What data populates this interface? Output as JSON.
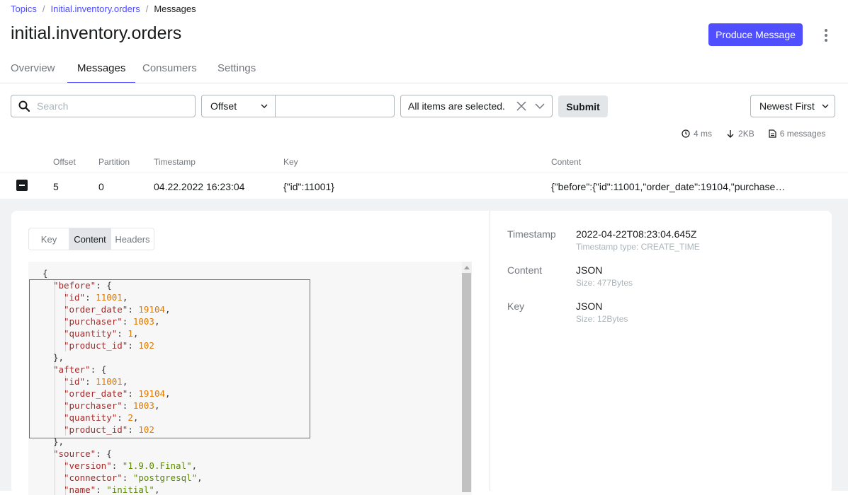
{
  "breadcrumb": {
    "topics": "Topics",
    "topic": "Initial.inventory.orders",
    "current": "Messages",
    "separator": "/"
  },
  "title": "initial.inventory.orders",
  "actions": {
    "produce": "Produce Message",
    "more_icon": "kebab-menu-icon"
  },
  "tabs": [
    {
      "label": "Overview",
      "active": false
    },
    {
      "label": "Messages",
      "active": true
    },
    {
      "label": "Consumers",
      "active": false
    },
    {
      "label": "Settings",
      "active": false
    }
  ],
  "filters": {
    "search_placeholder": "Search",
    "seek_type": "Offset",
    "offset_value": "",
    "partitions": "All items are selected.",
    "submit": "Submit",
    "sort": "Newest First"
  },
  "stats": {
    "time": "4 ms",
    "size": "2KB",
    "messages": "6 messages"
  },
  "table": {
    "headers": {
      "offset": "Offset",
      "partition": "Partition",
      "timestamp": "Timestamp",
      "key": "Key",
      "content": "Content"
    },
    "row": {
      "offset": "5",
      "partition": "0",
      "timestamp": "04.22.2022 16:23:04",
      "key": "{\"id\":11001}",
      "content": "{\"before\":{\"id\":11001,\"order_date\":19104,\"purchase…"
    }
  },
  "detail": {
    "tabs": [
      {
        "label": "Key",
        "active": false
      },
      {
        "label": "Content",
        "active": true
      },
      {
        "label": "Headers",
        "active": false
      }
    ],
    "meta": {
      "timestamp_label": "Timestamp",
      "timestamp_value": "2022-04-22T08:23:04.645Z",
      "timestamp_type": "Timestamp type: CREATE_TIME",
      "content_label": "Content",
      "content_value": "JSON",
      "content_size": "Size: 477Bytes",
      "key_label": "Key",
      "key_value": "JSON",
      "key_size": "Size: 12Bytes"
    },
    "code_lines": [
      [
        {
          "t": "p",
          "v": "{"
        }
      ],
      [
        {
          "t": "k",
          "v": "\"before\""
        },
        {
          "t": "p",
          "v": ": {"
        }
      ],
      [
        {
          "t": "k",
          "v": "\"id\""
        },
        {
          "t": "p",
          "v": ": "
        },
        {
          "t": "n",
          "v": "11001"
        },
        {
          "t": "p",
          "v": ","
        }
      ],
      [
        {
          "t": "k",
          "v": "\"order_date\""
        },
        {
          "t": "p",
          "v": ": "
        },
        {
          "t": "n",
          "v": "19104"
        },
        {
          "t": "p",
          "v": ","
        }
      ],
      [
        {
          "t": "k",
          "v": "\"purchaser\""
        },
        {
          "t": "p",
          "v": ": "
        },
        {
          "t": "n",
          "v": "1003"
        },
        {
          "t": "p",
          "v": ","
        }
      ],
      [
        {
          "t": "k",
          "v": "\"quantity\""
        },
        {
          "t": "p",
          "v": ": "
        },
        {
          "t": "n",
          "v": "1"
        },
        {
          "t": "p",
          "v": ","
        }
      ],
      [
        {
          "t": "k",
          "v": "\"product_id\""
        },
        {
          "t": "p",
          "v": ": "
        },
        {
          "t": "n",
          "v": "102"
        }
      ],
      [
        {
          "t": "p",
          "v": "},"
        }
      ],
      [
        {
          "t": "k",
          "v": "\"after\""
        },
        {
          "t": "p",
          "v": ": {"
        }
      ],
      [
        {
          "t": "k",
          "v": "\"id\""
        },
        {
          "t": "p",
          "v": ": "
        },
        {
          "t": "n",
          "v": "11001"
        },
        {
          "t": "p",
          "v": ","
        }
      ],
      [
        {
          "t": "k",
          "v": "\"order_date\""
        },
        {
          "t": "p",
          "v": ": "
        },
        {
          "t": "n",
          "v": "19104"
        },
        {
          "t": "p",
          "v": ","
        }
      ],
      [
        {
          "t": "k",
          "v": "\"purchaser\""
        },
        {
          "t": "p",
          "v": ": "
        },
        {
          "t": "n",
          "v": "1003"
        },
        {
          "t": "p",
          "v": ","
        }
      ],
      [
        {
          "t": "k",
          "v": "\"quantity\""
        },
        {
          "t": "p",
          "v": ": "
        },
        {
          "t": "n",
          "v": "2"
        },
        {
          "t": "p",
          "v": ","
        }
      ],
      [
        {
          "t": "k",
          "v": "\"product_id\""
        },
        {
          "t": "p",
          "v": ": "
        },
        {
          "t": "n",
          "v": "102"
        }
      ],
      [
        {
          "t": "p",
          "v": "},"
        }
      ],
      [
        {
          "t": "k",
          "v": "\"source\""
        },
        {
          "t": "p",
          "v": ": {"
        }
      ],
      [
        {
          "t": "k",
          "v": "\"version\""
        },
        {
          "t": "p",
          "v": ": "
        },
        {
          "t": "s",
          "v": "\"1.9.0.Final\""
        },
        {
          "t": "p",
          "v": ","
        }
      ],
      [
        {
          "t": "k",
          "v": "\"connector\""
        },
        {
          "t": "p",
          "v": ": "
        },
        {
          "t": "s",
          "v": "\"postgresql\""
        },
        {
          "t": "p",
          "v": ","
        }
      ],
      [
        {
          "t": "k",
          "v": "\"name\""
        },
        {
          "t": "p",
          "v": ": "
        },
        {
          "t": "s",
          "v": "\"initial\""
        },
        {
          "t": "p",
          "v": ","
        }
      ]
    ],
    "code_indents": [
      1,
      2,
      3,
      3,
      3,
      3,
      3,
      2,
      2,
      3,
      3,
      3,
      3,
      3,
      2,
      2,
      3,
      3,
      3
    ]
  },
  "colors": {
    "accent": "#4f4fff",
    "highlight": "#e23b3b",
    "json_key": "#a52a2a",
    "json_number": "#e07a00",
    "json_string": "#5b8a00"
  }
}
